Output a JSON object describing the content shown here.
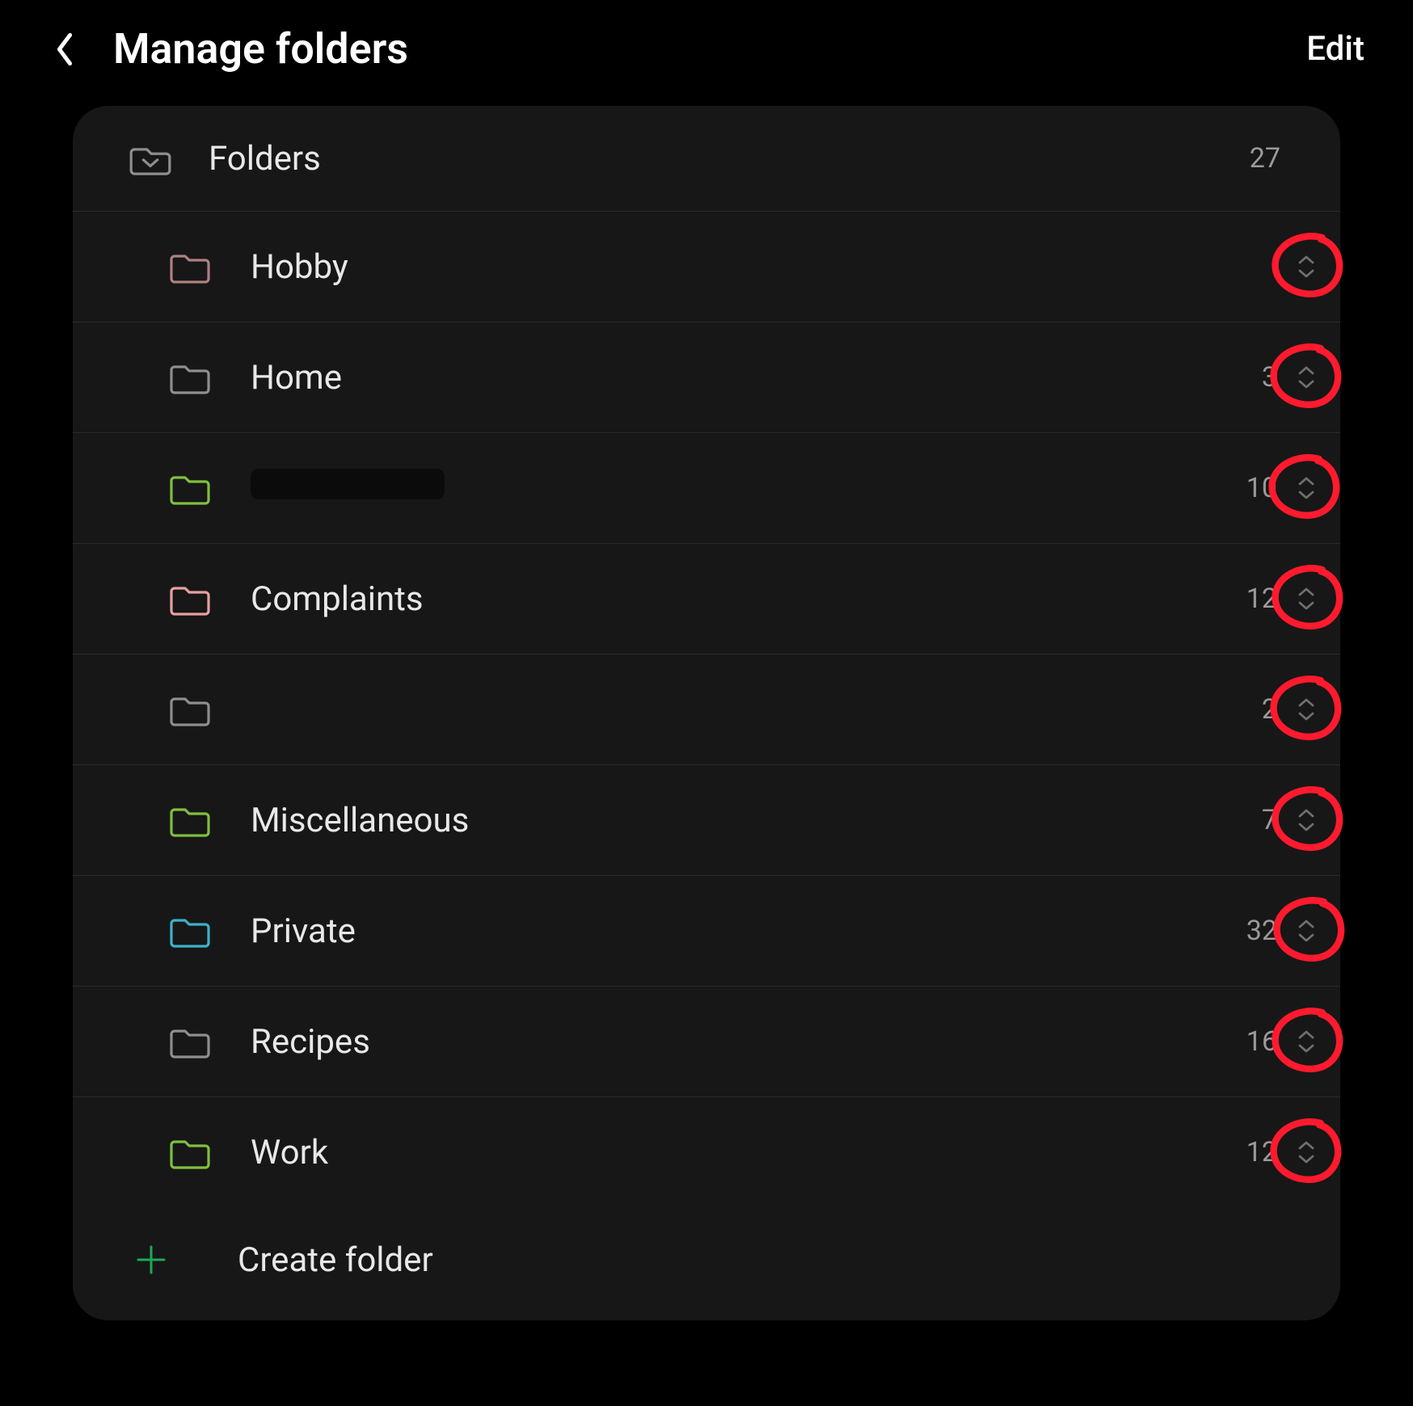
{
  "header": {
    "title": "Manage folders",
    "edit_label": "Edit"
  },
  "folders_section": {
    "label": "Folders",
    "total_count": "27"
  },
  "folders": [
    {
      "name": "Hobby",
      "count": "",
      "color": "#b08080",
      "redacted": false
    },
    {
      "name": "Home",
      "count": "3",
      "color": "#8e8e8e",
      "redacted": false
    },
    {
      "name": "",
      "count": "10",
      "color": "#7fbf3f",
      "redacted": true
    },
    {
      "name": "Complaints",
      "count": "12",
      "color": "#e8a0a0",
      "redacted": false
    },
    {
      "name": "",
      "count": "2",
      "color": "#8e8e8e",
      "redacted": false
    },
    {
      "name": "Miscellaneous",
      "count": "7",
      "color": "#7fbf3f",
      "redacted": false
    },
    {
      "name": "Private",
      "count": "32",
      "color": "#3fb0c9",
      "redacted": false
    },
    {
      "name": "Recipes",
      "count": "16",
      "color": "#8e8e8e",
      "redacted": false
    },
    {
      "name": "Work",
      "count": "12",
      "color": "#7fbf3f",
      "redacted": false
    }
  ],
  "create_folder_label": "Create folder",
  "annotation_color": "#ff1a2e",
  "icons": {
    "back": "chevron-left",
    "plus": "plus",
    "reorder": "chevron-up-down",
    "folder_root": "folder-open"
  }
}
